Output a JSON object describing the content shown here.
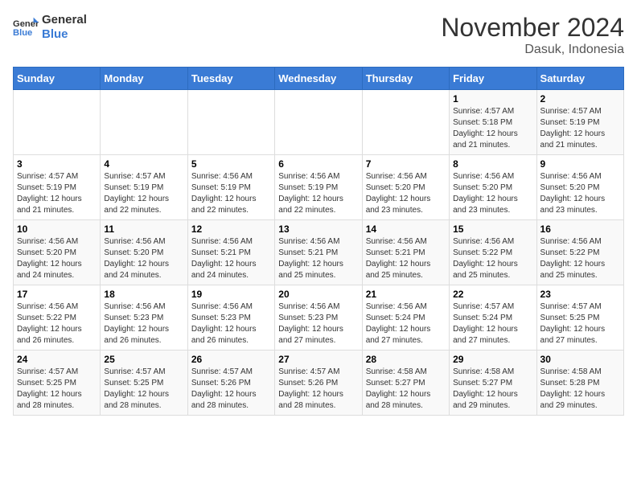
{
  "header": {
    "logo_line1": "General",
    "logo_line2": "Blue",
    "main_title": "November 2024",
    "subtitle": "Dasuk, Indonesia"
  },
  "calendar": {
    "days_of_week": [
      "Sunday",
      "Monday",
      "Tuesday",
      "Wednesday",
      "Thursday",
      "Friday",
      "Saturday"
    ],
    "weeks": [
      [
        {
          "day": "",
          "info": ""
        },
        {
          "day": "",
          "info": ""
        },
        {
          "day": "",
          "info": ""
        },
        {
          "day": "",
          "info": ""
        },
        {
          "day": "",
          "info": ""
        },
        {
          "day": "1",
          "info": "Sunrise: 4:57 AM\nSunset: 5:18 PM\nDaylight: 12 hours\nand 21 minutes."
        },
        {
          "day": "2",
          "info": "Sunrise: 4:57 AM\nSunset: 5:19 PM\nDaylight: 12 hours\nand 21 minutes."
        }
      ],
      [
        {
          "day": "3",
          "info": "Sunrise: 4:57 AM\nSunset: 5:19 PM\nDaylight: 12 hours\nand 21 minutes."
        },
        {
          "day": "4",
          "info": "Sunrise: 4:57 AM\nSunset: 5:19 PM\nDaylight: 12 hours\nand 22 minutes."
        },
        {
          "day": "5",
          "info": "Sunrise: 4:56 AM\nSunset: 5:19 PM\nDaylight: 12 hours\nand 22 minutes."
        },
        {
          "day": "6",
          "info": "Sunrise: 4:56 AM\nSunset: 5:19 PM\nDaylight: 12 hours\nand 22 minutes."
        },
        {
          "day": "7",
          "info": "Sunrise: 4:56 AM\nSunset: 5:20 PM\nDaylight: 12 hours\nand 23 minutes."
        },
        {
          "day": "8",
          "info": "Sunrise: 4:56 AM\nSunset: 5:20 PM\nDaylight: 12 hours\nand 23 minutes."
        },
        {
          "day": "9",
          "info": "Sunrise: 4:56 AM\nSunset: 5:20 PM\nDaylight: 12 hours\nand 23 minutes."
        }
      ],
      [
        {
          "day": "10",
          "info": "Sunrise: 4:56 AM\nSunset: 5:20 PM\nDaylight: 12 hours\nand 24 minutes."
        },
        {
          "day": "11",
          "info": "Sunrise: 4:56 AM\nSunset: 5:20 PM\nDaylight: 12 hours\nand 24 minutes."
        },
        {
          "day": "12",
          "info": "Sunrise: 4:56 AM\nSunset: 5:21 PM\nDaylight: 12 hours\nand 24 minutes."
        },
        {
          "day": "13",
          "info": "Sunrise: 4:56 AM\nSunset: 5:21 PM\nDaylight: 12 hours\nand 25 minutes."
        },
        {
          "day": "14",
          "info": "Sunrise: 4:56 AM\nSunset: 5:21 PM\nDaylight: 12 hours\nand 25 minutes."
        },
        {
          "day": "15",
          "info": "Sunrise: 4:56 AM\nSunset: 5:22 PM\nDaylight: 12 hours\nand 25 minutes."
        },
        {
          "day": "16",
          "info": "Sunrise: 4:56 AM\nSunset: 5:22 PM\nDaylight: 12 hours\nand 25 minutes."
        }
      ],
      [
        {
          "day": "17",
          "info": "Sunrise: 4:56 AM\nSunset: 5:22 PM\nDaylight: 12 hours\nand 26 minutes."
        },
        {
          "day": "18",
          "info": "Sunrise: 4:56 AM\nSunset: 5:23 PM\nDaylight: 12 hours\nand 26 minutes."
        },
        {
          "day": "19",
          "info": "Sunrise: 4:56 AM\nSunset: 5:23 PM\nDaylight: 12 hours\nand 26 minutes."
        },
        {
          "day": "20",
          "info": "Sunrise: 4:56 AM\nSunset: 5:23 PM\nDaylight: 12 hours\nand 27 minutes."
        },
        {
          "day": "21",
          "info": "Sunrise: 4:56 AM\nSunset: 5:24 PM\nDaylight: 12 hours\nand 27 minutes."
        },
        {
          "day": "22",
          "info": "Sunrise: 4:57 AM\nSunset: 5:24 PM\nDaylight: 12 hours\nand 27 minutes."
        },
        {
          "day": "23",
          "info": "Sunrise: 4:57 AM\nSunset: 5:25 PM\nDaylight: 12 hours\nand 27 minutes."
        }
      ],
      [
        {
          "day": "24",
          "info": "Sunrise: 4:57 AM\nSunset: 5:25 PM\nDaylight: 12 hours\nand 28 minutes."
        },
        {
          "day": "25",
          "info": "Sunrise: 4:57 AM\nSunset: 5:25 PM\nDaylight: 12 hours\nand 28 minutes."
        },
        {
          "day": "26",
          "info": "Sunrise: 4:57 AM\nSunset: 5:26 PM\nDaylight: 12 hours\nand 28 minutes."
        },
        {
          "day": "27",
          "info": "Sunrise: 4:57 AM\nSunset: 5:26 PM\nDaylight: 12 hours\nand 28 minutes."
        },
        {
          "day": "28",
          "info": "Sunrise: 4:58 AM\nSunset: 5:27 PM\nDaylight: 12 hours\nand 28 minutes."
        },
        {
          "day": "29",
          "info": "Sunrise: 4:58 AM\nSunset: 5:27 PM\nDaylight: 12 hours\nand 29 minutes."
        },
        {
          "day": "30",
          "info": "Sunrise: 4:58 AM\nSunset: 5:28 PM\nDaylight: 12 hours\nand 29 minutes."
        }
      ]
    ]
  }
}
